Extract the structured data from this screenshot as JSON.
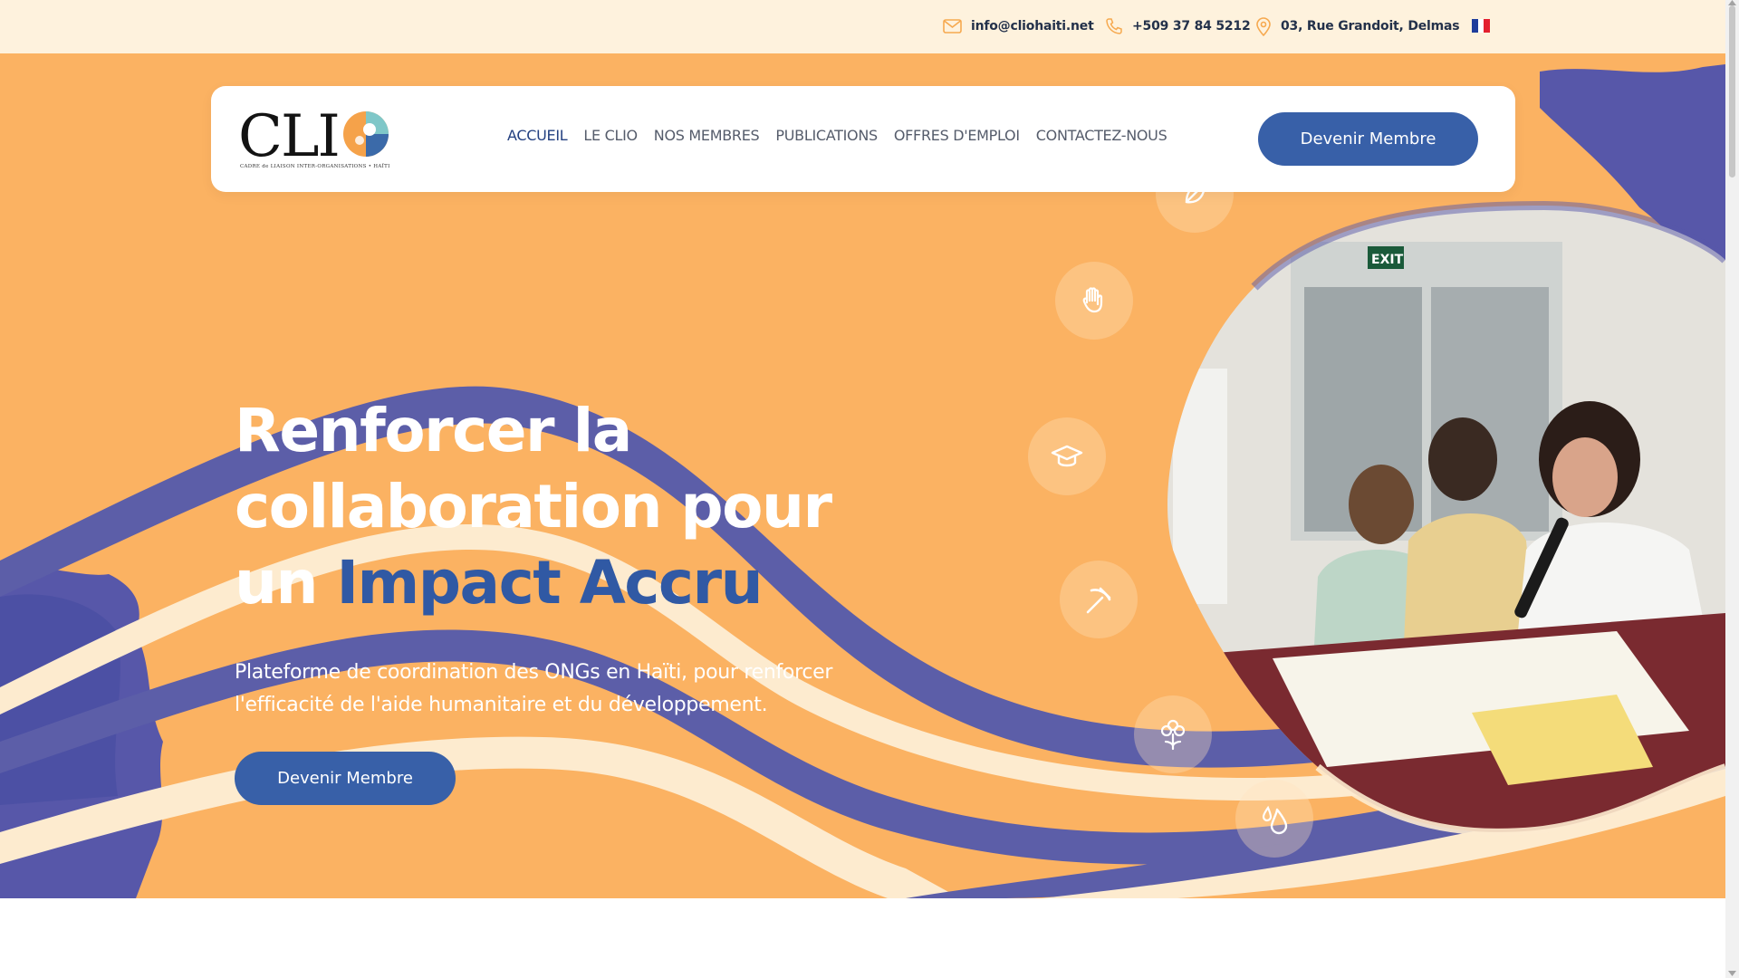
{
  "topbar": {
    "email": "info@cliohaiti.net",
    "phone": "+509 37 84 5212",
    "address": "03, Rue Grandoit, Delmas",
    "email_icon": "mail-icon",
    "phone_icon": "phone-icon",
    "address_icon": "map-pin-icon",
    "language_flag": "french-flag-icon"
  },
  "header": {
    "logo_text": "CLI",
    "logo_subtitle": "CADRE de LIAISON INTER-ORGANISATIONS • HAÏTI",
    "nav": [
      {
        "label": "ACCUEIL",
        "active": true
      },
      {
        "label": "LE CLIO",
        "active": false
      },
      {
        "label": "NOS MEMBRES",
        "active": false
      },
      {
        "label": "PUBLICATIONS",
        "active": false
      },
      {
        "label": "OFFRES D'EMPLOI",
        "active": false
      },
      {
        "label": "CONTACTEZ-NOUS",
        "active": false
      }
    ],
    "cta_label": "Devenir Membre"
  },
  "hero": {
    "headline_part1": "Renforcer la collaboration pour un",
    "headline_accent": "Impact Accru",
    "subtitle": "Plateforme de coordination des ONGs en Haïti, pour renforcer l'efficacité de l'aide humanitaire et du développement.",
    "cta_label": "Devenir Membre",
    "icons": [
      "hand-icon",
      "graduation-cap-icon",
      "pickaxe-icon",
      "flower-icon",
      "water-drop-icon",
      "leaf-icon"
    ]
  },
  "colors": {
    "topbar_bg": "#fef2dd",
    "hero_bg": "#fbb262",
    "accent_blue": "#3860a8",
    "wave_purple": "#5b5fa6",
    "wave_cream": "#fdebcf",
    "headline_accent": "#3059a4"
  }
}
